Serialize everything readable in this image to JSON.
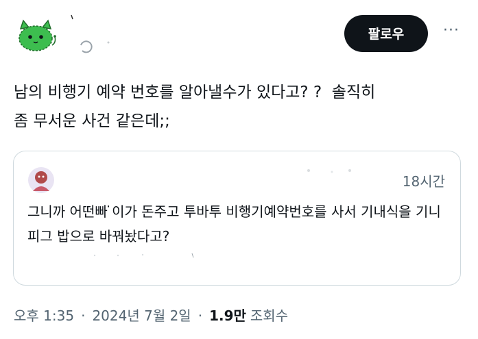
{
  "tweet": {
    "text": "남의 비행기 예약 번호를 알아낼수가 있다고? ?  솔직히\n좀 무서운 사건 같은데;;"
  },
  "header": {
    "follow_label": "팔로우",
    "more_icon": "more-dots-icon",
    "avatar_icon": "green-cat-avatar-icon"
  },
  "quote": {
    "time": "18시간",
    "text": "그니까 어떤빠  ̇이가 돈주고 투바투 비행기예약번호를 사서 기내식을 기니피그 밥으로 바꿔놨다고?",
    "avatar_icon": "pink-avatar-icon"
  },
  "meta": {
    "time": "오후 1:35",
    "date": "2024년 7월 2일",
    "views_count": "1.9만",
    "views_label": "조회수"
  },
  "colors": {
    "follow_bg": "#0f1419",
    "secondary_text": "#536471",
    "border": "#cfd9de",
    "avatar_green": "#3dbd4f"
  }
}
